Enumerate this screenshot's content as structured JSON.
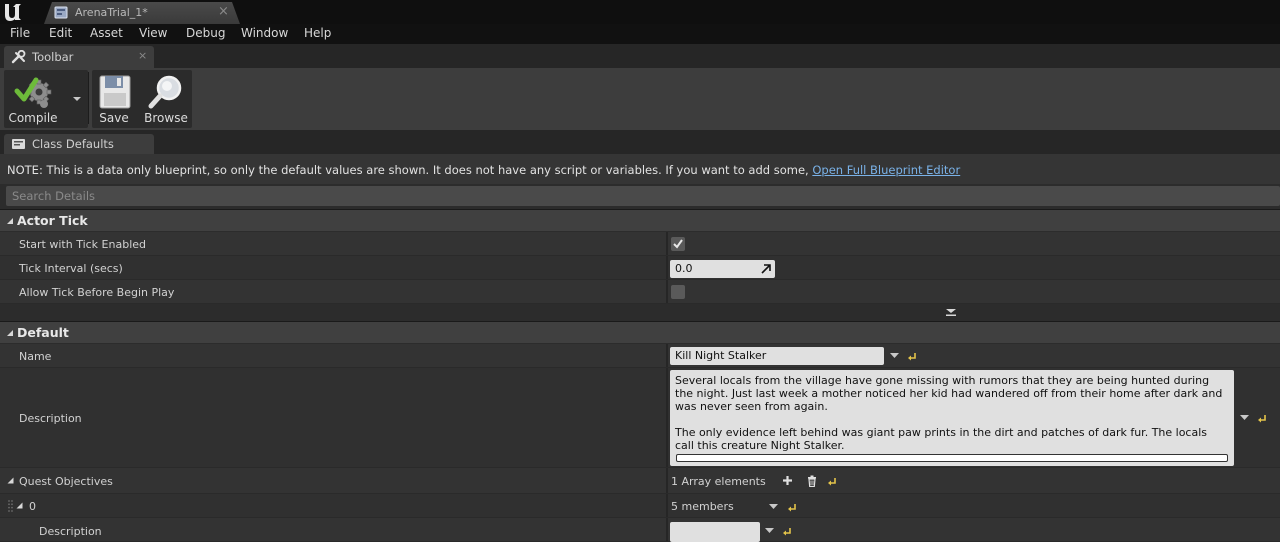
{
  "window": {
    "document_tab": "ArenaTrial_1*"
  },
  "menu": [
    "File",
    "Edit",
    "Asset",
    "View",
    "Debug",
    "Window",
    "Help"
  ],
  "toolbar_panel": {
    "tab_label": "Toolbar",
    "buttons": {
      "compile": "Compile",
      "save": "Save",
      "browse": "Browse"
    }
  },
  "class_defaults": {
    "tab_label": "Class Defaults",
    "note": "NOTE: This is a data only blueprint, so only the default values are shown.  It does not have any script or variables.  If you want to add some,",
    "note_link": "Open Full Blueprint Editor",
    "search_placeholder": "Search Details"
  },
  "actor_tick": {
    "header": "Actor Tick",
    "start_with_tick_enabled": {
      "label": "Start with Tick Enabled",
      "checked": true
    },
    "tick_interval": {
      "label": "Tick Interval (secs)",
      "value": "0.0"
    },
    "allow_tick_before_begin_play": {
      "label": "Allow Tick Before Begin Play",
      "checked": false
    }
  },
  "default": {
    "header": "Default",
    "name": {
      "label": "Name",
      "value": "Kill Night Stalker"
    },
    "description": {
      "label": "Description",
      "paragraph1": "Several locals from the village have gone missing with rumors that they are being hunted during the night. Just last week a mother noticed her kid had wandered off from their home after dark and was never seen from again.",
      "paragraph2": "The only evidence left behind was giant paw prints in the dirt and patches of dark fur. The locals call this creature Night Stalker."
    },
    "quest_objectives": {
      "label": "Quest Objectives",
      "count_text": "1 Array elements"
    },
    "element_0": {
      "index": "0",
      "members_text": "5 members"
    },
    "element_0_description": {
      "label": "Description",
      "value": ""
    }
  },
  "colors": {
    "link": "#7ab2e8",
    "compile_check": "#6dbb3a",
    "reset_arrow": "#e4c44a"
  }
}
